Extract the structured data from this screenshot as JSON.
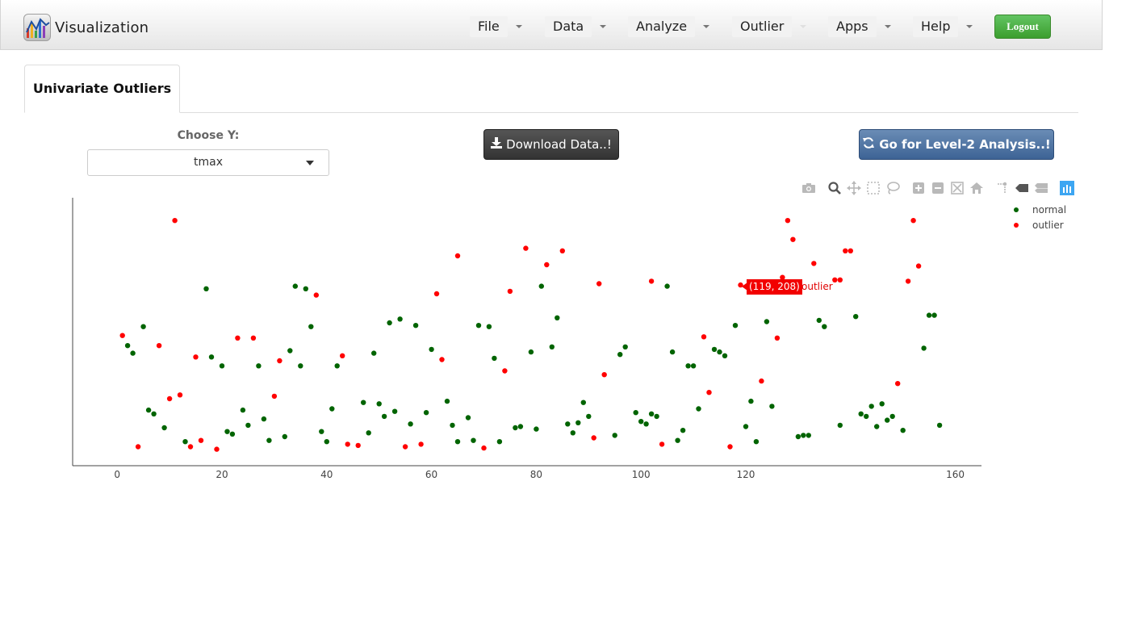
{
  "navbar": {
    "brand": "Visualization",
    "menus": [
      {
        "label": "File"
      },
      {
        "label": "Data"
      },
      {
        "label": "Analyze"
      },
      {
        "label": "Outlier"
      },
      {
        "label": "Apps"
      },
      {
        "label": "Help"
      }
    ],
    "logout_label": "Logout",
    "logout_color": "#4cae3c"
  },
  "tabs": [
    {
      "label": "Univariate Outliers",
      "active": true
    }
  ],
  "controls": {
    "choose_y_label": "Choose Y:",
    "choose_y_value": "tmax",
    "download_label": "Download Data..!",
    "download_icon": "download-icon",
    "level2_label": "Go for Level-2 Analysis..!",
    "level2_icon": "refresh-icon"
  },
  "modebar": [
    "camera-icon",
    "zoom-icon",
    "pan-icon",
    "box-select-icon",
    "lasso-select-icon",
    "zoom-in-icon",
    "zoom-out-icon",
    "autoscale-icon",
    "reset-axes-icon",
    "spike-lines-icon",
    "hover-closest-icon",
    "hover-compare-icon",
    "plotly-logo-icon"
  ],
  "legend": [
    {
      "name": "normal",
      "color": "#006400"
    },
    {
      "name": "outlier",
      "color": "#ff0000"
    }
  ],
  "tooltip": {
    "text": "(119, 208)",
    "name": "outlier",
    "color": "#f20000"
  },
  "chart_data": {
    "type": "scatter",
    "xlabel": "",
    "ylabel": "",
    "xlim": [
      -8.5,
      165
    ],
    "ylim": [
      71,
      283
    ],
    "xticks": [
      "0",
      "20",
      "40",
      "60",
      "80",
      "100",
      "120",
      "160"
    ],
    "y_tick_labels_shown": false,
    "grid": false,
    "legend_position": "top-right",
    "series": [
      {
        "name": "normal",
        "color": "#006400",
        "points": [
          [
            2,
            166
          ],
          [
            3,
            160
          ],
          [
            5,
            181
          ],
          [
            6,
            115
          ],
          [
            7,
            112
          ],
          [
            9,
            101
          ],
          [
            13,
            90
          ],
          [
            17,
            211
          ],
          [
            18,
            157
          ],
          [
            20,
            150
          ],
          [
            21,
            98
          ],
          [
            22,
            96
          ],
          [
            24,
            115
          ],
          [
            25,
            103
          ],
          [
            27,
            150
          ],
          [
            28,
            108
          ],
          [
            29,
            91
          ],
          [
            32,
            94
          ],
          [
            33,
            162
          ],
          [
            34,
            213
          ],
          [
            35,
            150
          ],
          [
            36,
            211
          ],
          [
            37,
            181
          ],
          [
            39,
            98
          ],
          [
            40,
            90
          ],
          [
            41,
            116
          ],
          [
            42,
            150
          ],
          [
            47,
            121
          ],
          [
            48,
            97
          ],
          [
            49,
            160
          ],
          [
            50,
            120
          ],
          [
            51,
            110
          ],
          [
            53,
            114
          ],
          [
            52,
            184
          ],
          [
            54,
            187
          ],
          [
            56,
            104
          ],
          [
            57,
            182
          ],
          [
            59,
            113
          ],
          [
            60,
            163
          ],
          [
            63,
            122
          ],
          [
            64,
            103
          ],
          [
            65,
            90
          ],
          [
            67,
            109
          ],
          [
            68,
            91
          ],
          [
            69,
            182
          ],
          [
            71,
            181
          ],
          [
            72,
            156
          ],
          [
            73,
            90
          ],
          [
            76,
            101
          ],
          [
            77,
            102
          ],
          [
            80,
            100
          ],
          [
            79,
            161
          ],
          [
            81,
            213
          ],
          [
            83,
            165
          ],
          [
            84,
            188
          ],
          [
            86,
            104
          ],
          [
            87,
            97
          ],
          [
            88,
            105
          ],
          [
            89,
            121
          ],
          [
            90,
            110
          ],
          [
            95,
            95
          ],
          [
            96,
            159
          ],
          [
            97,
            165
          ],
          [
            99,
            113
          ],
          [
            100,
            106
          ],
          [
            101,
            104
          ],
          [
            102,
            112
          ],
          [
            103,
            110
          ],
          [
            105,
            213
          ],
          [
            106,
            161
          ],
          [
            107,
            91
          ],
          [
            108,
            99
          ],
          [
            109,
            150
          ],
          [
            110,
            150
          ],
          [
            111,
            116
          ],
          [
            114,
            163
          ],
          [
            115,
            161
          ],
          [
            116,
            158
          ],
          [
            118,
            182
          ],
          [
            120,
            102
          ],
          [
            121,
            122
          ],
          [
            122,
            90
          ],
          [
            124,
            185
          ],
          [
            125,
            118
          ],
          [
            130,
            94
          ],
          [
            131,
            95
          ],
          [
            132,
            95
          ],
          [
            134,
            186
          ],
          [
            135,
            181
          ],
          [
            138,
            103
          ],
          [
            141,
            189
          ],
          [
            142,
            112
          ],
          [
            143,
            110
          ],
          [
            144,
            118
          ],
          [
            145,
            102
          ],
          [
            146,
            120
          ],
          [
            147,
            107
          ],
          [
            148,
            110
          ],
          [
            150,
            99
          ],
          [
            154,
            164
          ],
          [
            155,
            190
          ],
          [
            156,
            190
          ],
          [
            157,
            103
          ]
        ]
      },
      {
        "name": "outlier",
        "color": "#ff0000",
        "points": [
          [
            1,
            174
          ],
          [
            4,
            86
          ],
          [
            8,
            166
          ],
          [
            10,
            124
          ],
          [
            11,
            265
          ],
          [
            12,
            127
          ],
          [
            14,
            86
          ],
          [
            15,
            157
          ],
          [
            16,
            91
          ],
          [
            19,
            84
          ],
          [
            23,
            172
          ],
          [
            26,
            172
          ],
          [
            30,
            126
          ],
          [
            31,
            154
          ],
          [
            38,
            206
          ],
          [
            43,
            158
          ],
          [
            44,
            88
          ],
          [
            46,
            87
          ],
          [
            55,
            86
          ],
          [
            58,
            88
          ],
          [
            61,
            207
          ],
          [
            62,
            155
          ],
          [
            65,
            237
          ],
          [
            70,
            85
          ],
          [
            74,
            146
          ],
          [
            75,
            209
          ],
          [
            78,
            243
          ],
          [
            82,
            230
          ],
          [
            85,
            241
          ],
          [
            91,
            93
          ],
          [
            92,
            215
          ],
          [
            93,
            143
          ],
          [
            102,
            217
          ],
          [
            104,
            88
          ],
          [
            112,
            173
          ],
          [
            113,
            129
          ],
          [
            117,
            86
          ],
          [
            119,
            214
          ],
          [
            123,
            138
          ],
          [
            126,
            172
          ],
          [
            127,
            220
          ],
          [
            128,
            265
          ],
          [
            129,
            250
          ],
          [
            133,
            231
          ],
          [
            137,
            218
          ],
          [
            138,
            218
          ],
          [
            139,
            241
          ],
          [
            140,
            241
          ],
          [
            149,
            136
          ],
          [
            151,
            217
          ],
          [
            152,
            265
          ],
          [
            153,
            229
          ]
        ]
      }
    ]
  }
}
